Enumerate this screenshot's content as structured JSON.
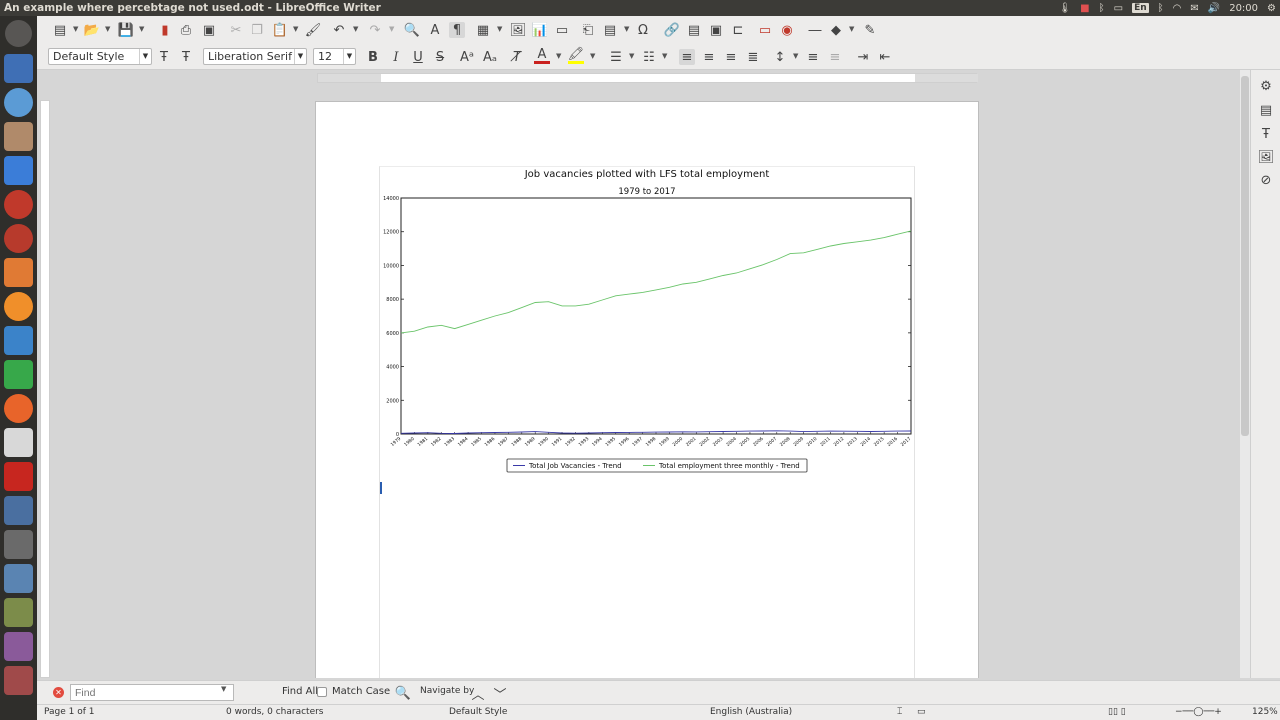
{
  "window": {
    "title": "An example where percebtage not used.odt - LibreOffice Writer"
  },
  "tray": {
    "keyboard": "En",
    "clock": "20:00"
  },
  "formatting": {
    "paragraph_style": "Default Style",
    "font_name": "Liberation Serif",
    "font_size": "12"
  },
  "find_toolbar": {
    "placeholder": "Find",
    "find_all_label": "Find All",
    "match_case_label": "Match Case",
    "navigate_by_label": "Navigate by"
  },
  "statusbar": {
    "page": "Page 1 of 1",
    "words": "0 words, 0 characters",
    "page_style": "Default Style",
    "language": "English (Australia)",
    "zoom": "125%"
  },
  "chart_data": {
    "type": "line",
    "title": "Job vacancies plotted with LFS total employment",
    "subtitle": "1979 to 2017",
    "xlabel": "",
    "ylabel": "",
    "ylim": [
      0,
      14000
    ],
    "yticks": [
      0,
      2000,
      4000,
      6000,
      8000,
      10000,
      12000,
      14000
    ],
    "xlim": [
      1979,
      2017
    ],
    "legend_position": "bottom-center",
    "grid": false,
    "x": [
      1979,
      1980,
      1981,
      1982,
      1983,
      1984,
      1985,
      1986,
      1987,
      1988,
      1989,
      1990,
      1991,
      1992,
      1993,
      1994,
      1995,
      1996,
      1997,
      1998,
      1999,
      2000,
      2001,
      2002,
      2003,
      2004,
      2005,
      2006,
      2007,
      2008,
      2009,
      2010,
      2011,
      2012,
      2013,
      2014,
      2015,
      2016,
      2017
    ],
    "series": [
      {
        "name": "Total Job Vacancies - Trend",
        "color": "#3a3aa8",
        "values": [
          40,
          60,
          80,
          40,
          30,
          60,
          80,
          90,
          100,
          120,
          140,
          100,
          60,
          50,
          60,
          80,
          90,
          95,
          100,
          110,
          120,
          130,
          125,
          135,
          150,
          160,
          170,
          180,
          190,
          170,
          140,
          160,
          175,
          165,
          160,
          150,
          160,
          170,
          180
        ]
      },
      {
        "name": "Total employment three monthly - Trend",
        "color": "#6ac46a",
        "values": [
          6000,
          6100,
          6350,
          6450,
          6250,
          6500,
          6750,
          7000,
          7200,
          7500,
          7800,
          7850,
          7600,
          7600,
          7700,
          7950,
          8200,
          8300,
          8400,
          8550,
          8700,
          8900,
          9000,
          9200,
          9400,
          9550,
          9800,
          10050,
          10350,
          10700,
          10750,
          10950,
          11150,
          11300,
          11400,
          11500,
          11650,
          11850,
          12050
        ]
      }
    ]
  }
}
